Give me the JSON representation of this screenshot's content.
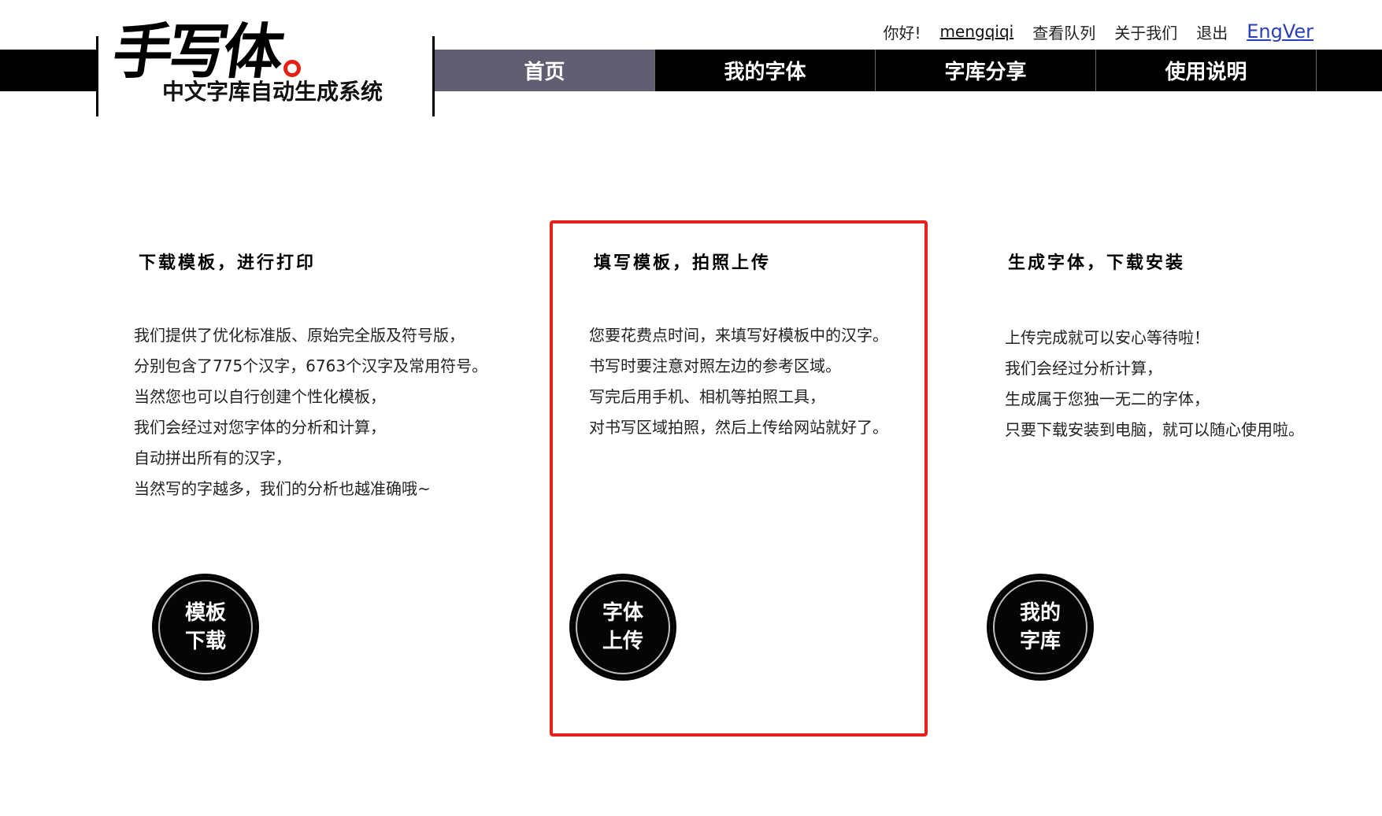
{
  "header": {
    "logo": {
      "title": "手写体",
      "subtitle": "中文字库自动生成系统"
    },
    "userbar": {
      "greeting": "你好!",
      "username": "mengqiqi",
      "queue_link": "查看队列",
      "about_link": "关于我们",
      "logout_link": "退出",
      "english_link": "EngVer"
    },
    "nav": {
      "tabs": [
        {
          "label": "首页",
          "active": true
        },
        {
          "label": "我的字体",
          "active": false
        },
        {
          "label": "字库分享",
          "active": false
        },
        {
          "label": "使用说明",
          "active": false
        }
      ]
    }
  },
  "steps": [
    {
      "title": "下载模板，进行打印",
      "lines": [
        "我们提供了优化标准版、原始完全版及符号版，",
        "分别包含了775个汉字，6763个汉字及常用符号。",
        "当然您也可以自行创建个性化模板，",
        "我们会经过对您字体的分析和计算，",
        "自动拼出所有的汉字，",
        "当然写的字越多，我们的分析也越准确哦~"
      ],
      "button": {
        "line1": "模板",
        "line2": "下载"
      },
      "highlighted": false
    },
    {
      "title": "填写模板，拍照上传",
      "lines": [
        "您要花费点时间，来填写好模板中的汉字。",
        "书写时要注意对照左边的参考区域。",
        "写完后用手机、相机等拍照工具，",
        "对书写区域拍照，然后上传给网站就好了。"
      ],
      "button": {
        "line1": "字体",
        "line2": "上传"
      },
      "highlighted": true
    },
    {
      "title": "生成字体，下载安装",
      "lines": [
        "上传完成就可以安心等待啦！",
        "我们会经过分析计算，",
        "生成属于您独一无二的字体，",
        "只要下载安装到电脑，就可以随心使用啦。"
      ],
      "button": {
        "line1": "我的",
        "line2": "字库"
      },
      "highlighted": false
    }
  ],
  "colors": {
    "nav_background": "#000000",
    "nav_active": "#615e72",
    "highlight_border": "#e3231b",
    "logo_seal": "#e52117",
    "eng_link": "#2a3fb8"
  }
}
